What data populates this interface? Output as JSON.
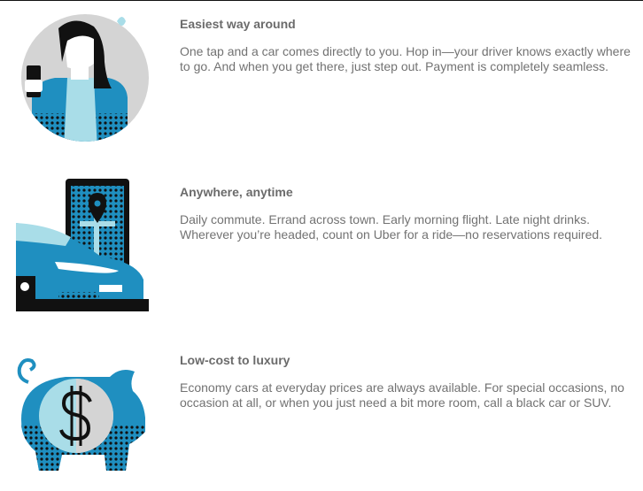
{
  "features": [
    {
      "title": "Easiest way around",
      "body": "One tap and a car comes directly to you. Hop in—your driver knows exactly where to go. And when you get there, just step out. Payment is completely seamless.",
      "icon": "rider-phone-illustration"
    },
    {
      "title": "Anywhere, anytime",
      "body": "Daily commute. Errand across town. Early morning flight. Late night drinks. Wherever you’re headed, count on Uber for a ride—no reservations required.",
      "icon": "car-phone-map-illustration"
    },
    {
      "title": "Low-cost to luxury",
      "body": "Economy cars at everyday prices are always available. For special occasions, no occasion at all, or when you just need a bit more room, call a black car or SUV.",
      "icon": "piggy-bank-dollar-illustration"
    }
  ],
  "colors": {
    "accent": "#1f8fc0",
    "light_accent": "#a9dde8",
    "grey": "#d4d4d4",
    "dark": "#111111"
  }
}
